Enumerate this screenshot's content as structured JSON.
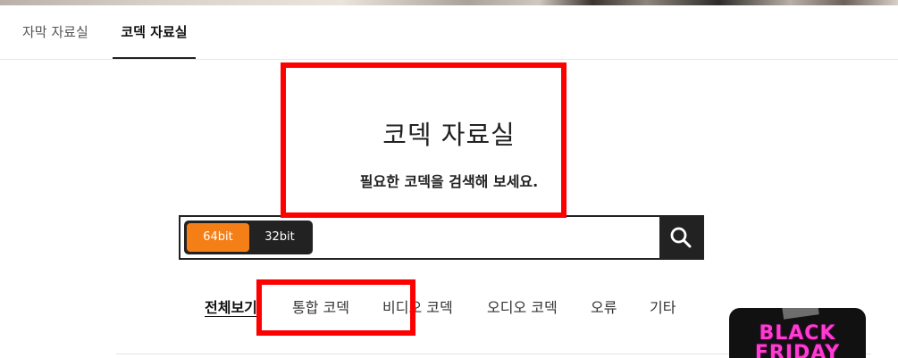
{
  "tabs": [
    {
      "label": "자막 자료실",
      "active": false
    },
    {
      "label": "코덱 자료실",
      "active": true
    }
  ],
  "page": {
    "title": "코덱 자료실",
    "subtitle": "필요한 코덱을 검색해 보세요."
  },
  "search": {
    "bit_options": [
      "64bit",
      "32bit"
    ],
    "selected_bit": "64bit",
    "placeholder": "",
    "value": "",
    "button_icon": "search-icon"
  },
  "categories": [
    {
      "label": "전체보기",
      "active": true
    },
    {
      "label": "통합 코덱",
      "active": false
    },
    {
      "label": "비디오 코덱",
      "active": false
    },
    {
      "label": "오디오 코덱",
      "active": false
    },
    {
      "label": "오류",
      "active": false
    },
    {
      "label": "기타",
      "active": false
    }
  ],
  "promo": {
    "text": "BLACK FRIDAY"
  },
  "colors": {
    "accent": "#f57f17",
    "dark": "#222222",
    "annotation": "#ff0000",
    "promo_text": "#ff3bd2"
  }
}
